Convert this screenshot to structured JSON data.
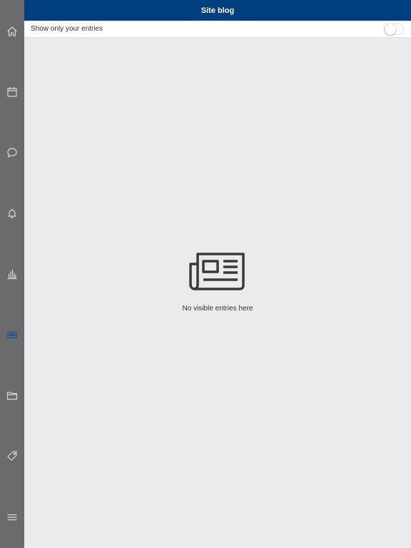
{
  "header": {
    "title": "Site blog"
  },
  "filter": {
    "label": "Show only your entries",
    "toggle_on": false
  },
  "empty_state": {
    "message": "No visible entries here",
    "icon": "newspaper-icon"
  },
  "sidebar": {
    "items": [
      {
        "icon": "home-icon"
      },
      {
        "icon": "calendar-icon"
      },
      {
        "icon": "chat-icon"
      },
      {
        "icon": "bell-icon"
      },
      {
        "icon": "bar-chart-icon"
      },
      {
        "icon": "blog-icon",
        "active": true
      },
      {
        "icon": "folder-icon"
      },
      {
        "icon": "tag-icon"
      },
      {
        "icon": "menu-icon"
      }
    ]
  },
  "colors": {
    "header_bg": "#003f80",
    "sidebar_bg": "#6b6b6d",
    "content_bg": "#ebeaec",
    "active_icon": "#1d4f8e"
  }
}
